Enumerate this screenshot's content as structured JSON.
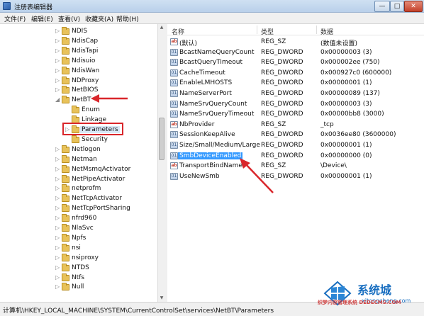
{
  "window": {
    "title": "注册表编辑器",
    "controls": {
      "minimize": "—",
      "maximize": "□",
      "close": "✕"
    }
  },
  "menu": [
    "文件(F)",
    "编辑(E)",
    "查看(V)",
    "收藏夹(A)",
    "帮助(H)"
  ],
  "tree": {
    "items": [
      {
        "label": "NDIS",
        "expander": "▷",
        "level": 0
      },
      {
        "label": "NdisCap",
        "expander": "▷",
        "level": 0
      },
      {
        "label": "NdisTapi",
        "expander": "▷",
        "level": 0
      },
      {
        "label": "Ndisuio",
        "expander": "▷",
        "level": 0
      },
      {
        "label": "NdisWan",
        "expander": "▷",
        "level": 0
      },
      {
        "label": "NDProxy",
        "expander": "▷",
        "level": 0
      },
      {
        "label": "NetBIOS",
        "expander": "▷",
        "level": 0
      },
      {
        "label": "NetBT",
        "expander": "◢",
        "level": 0
      },
      {
        "label": "Enum",
        "expander": "",
        "level": 1
      },
      {
        "label": "Linkage",
        "expander": "",
        "level": 1
      },
      {
        "label": "Parameters",
        "expander": "▷",
        "level": 1,
        "selected": true
      },
      {
        "label": "Security",
        "expander": "",
        "level": 1
      },
      {
        "label": "Netlogon",
        "expander": "▷",
        "level": 0
      },
      {
        "label": "Netman",
        "expander": "▷",
        "level": 0
      },
      {
        "label": "NetMsmqActivator",
        "expander": "▷",
        "level": 0
      },
      {
        "label": "NetPipeActivator",
        "expander": "▷",
        "level": 0
      },
      {
        "label": "netprofm",
        "expander": "▷",
        "level": 0
      },
      {
        "label": "NetTcpActivator",
        "expander": "▷",
        "level": 0
      },
      {
        "label": "NetTcpPortSharing",
        "expander": "▷",
        "level": 0
      },
      {
        "label": "nfrd960",
        "expander": "▷",
        "level": 0
      },
      {
        "label": "NlaSvc",
        "expander": "▷",
        "level": 0
      },
      {
        "label": "Npfs",
        "expander": "▷",
        "level": 0
      },
      {
        "label": "nsi",
        "expander": "▷",
        "level": 0
      },
      {
        "label": "nsiproxy",
        "expander": "▷",
        "level": 0
      },
      {
        "label": "NTDS",
        "expander": "▷",
        "level": 0
      },
      {
        "label": "Ntfs",
        "expander": "▷",
        "level": 0
      },
      {
        "label": "Null",
        "expander": "▷",
        "level": 0
      }
    ]
  },
  "list": {
    "headers": {
      "name": "名称",
      "type": "类型",
      "data": "数据"
    },
    "rows": [
      {
        "icon": "string-value-icon",
        "badge": "ab",
        "name": "(默认)",
        "type": "REG_SZ",
        "data": "(数值未设置)"
      },
      {
        "icon": "binary-value-icon",
        "badge": "01",
        "name": "BcastNameQueryCount",
        "type": "REG_DWORD",
        "data": "0x00000003 (3)"
      },
      {
        "icon": "binary-value-icon",
        "badge": "01",
        "name": "BcastQueryTimeout",
        "type": "REG_DWORD",
        "data": "0x000002ee (750)"
      },
      {
        "icon": "binary-value-icon",
        "badge": "01",
        "name": "CacheTimeout",
        "type": "REG_DWORD",
        "data": "0x000927c0 (600000)"
      },
      {
        "icon": "binary-value-icon",
        "badge": "01",
        "name": "EnableLMHOSTS",
        "type": "REG_DWORD",
        "data": "0x00000001 (1)"
      },
      {
        "icon": "binary-value-icon",
        "badge": "01",
        "name": "NameServerPort",
        "type": "REG_DWORD",
        "data": "0x00000089 (137)"
      },
      {
        "icon": "binary-value-icon",
        "badge": "01",
        "name": "NameSrvQueryCount",
        "type": "REG_DWORD",
        "data": "0x00000003 (3)"
      },
      {
        "icon": "binary-value-icon",
        "badge": "01",
        "name": "NameSrvQueryTimeout",
        "type": "REG_DWORD",
        "data": "0x00000bb8 (3000)"
      },
      {
        "icon": "string-value-icon",
        "badge": "ab",
        "name": "NbProvider",
        "type": "REG_SZ",
        "data": "_tcp"
      },
      {
        "icon": "binary-value-icon",
        "badge": "01",
        "name": "SessionKeepAlive",
        "type": "REG_DWORD",
        "data": "0x0036ee80 (3600000)"
      },
      {
        "icon": "binary-value-icon",
        "badge": "01",
        "name": "Size/Small/Medium/Large",
        "type": "REG_DWORD",
        "data": "0x00000001 (1)"
      },
      {
        "icon": "binary-value-icon",
        "badge": "01",
        "name": "SmbDeviceEnabled",
        "type": "REG_DWORD",
        "data": "0x00000000 (0)",
        "selected": true
      },
      {
        "icon": "string-value-icon",
        "badge": "ab",
        "name": "TransportBindName",
        "type": "REG_SZ",
        "data": "\\Device\\"
      },
      {
        "icon": "binary-value-icon",
        "badge": "01",
        "name": "UseNewSmb",
        "type": "REG_DWORD",
        "data": "0x00000001 (1)"
      }
    ]
  },
  "status": {
    "path": "计算机\\HKEY_LOCAL_MACHINE\\SYSTEM\\CurrentControlSet\\services\\NetBT\\Parameters"
  },
  "annotations": {
    "color": "#d9262b"
  },
  "watermark": {
    "brand": "系统城",
    "site": "xitongcheng.com",
    "left_text": "织梦内容管理系统 DEDECMS.COM"
  }
}
